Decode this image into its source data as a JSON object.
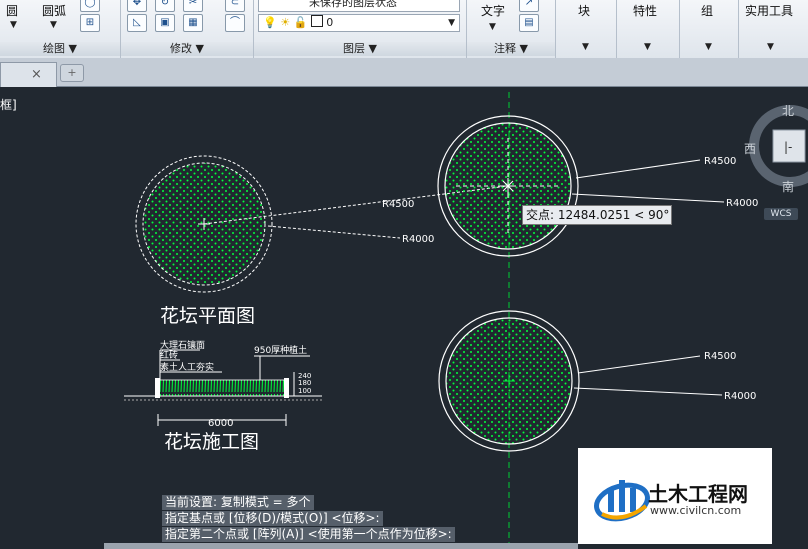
{
  "ribbon": {
    "panels": [
      {
        "label": "绘图 ▼"
      },
      {
        "label": "修改 ▼"
      },
      {
        "label": "图层 ▼"
      },
      {
        "label": "注释 ▼"
      }
    ],
    "draw_tools": {
      "circle": "圆",
      "arc": "圆弧"
    },
    "layer_state": "未保存的图层状态",
    "layer_current": "0",
    "annotation_text": "文字",
    "block": "块",
    "properties": "特性",
    "group": "组",
    "utilities": "实用工具"
  },
  "tabs": {
    "close": "×",
    "new": "+"
  },
  "viewport": {
    "label": "框]"
  },
  "drawing": {
    "plan_title": "花坛平面图",
    "section_title": "花坛施工图",
    "radius_4500": "R4500",
    "radius_4000": "R4000",
    "section_labels": {
      "stone": "大理石镶面",
      "brick": "红砖",
      "fill": "素土人工夯实",
      "soil": "950厚种植土",
      "dim_6000": "6000",
      "dim_240": "240",
      "dim_180": "180",
      "dim_100": "100"
    }
  },
  "tooltip": "交点: 12484.0251 < 90°",
  "compass": {
    "north": "北",
    "west": "西",
    "south": "南",
    "wcs": "WCS"
  },
  "command_lines": [
    "当前设置:  复制模式 = 多个",
    "指定基点或 [位移(D)/模式(O)] <位移>:",
    "指定第二个点或 [阵列(A)] <使用第一个点作为位移>:"
  ],
  "logo": {
    "name": "土木工程网",
    "url": "www.civilcn.com"
  },
  "colors": {
    "canvas_bg": "#212830",
    "hatch": "#00ff3c",
    "axis": "#00cc33"
  }
}
